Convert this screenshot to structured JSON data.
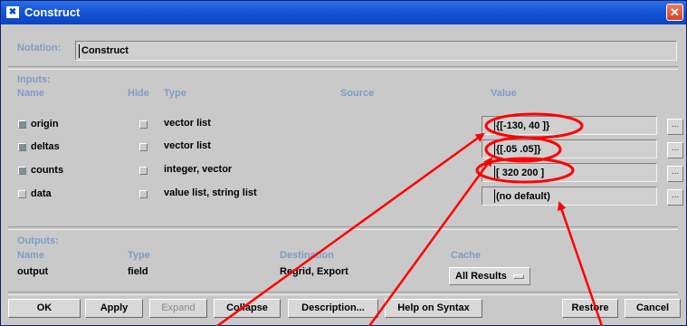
{
  "window": {
    "title": "Construct",
    "icon": "module-icon",
    "close_glyph": "✕"
  },
  "notation": {
    "label": "Notation:",
    "value": "Construct"
  },
  "inputs": {
    "section_label": "Inputs:",
    "headers": {
      "name": "Name",
      "hide": "Hide",
      "type": "Type",
      "source": "Source",
      "value": "Value"
    },
    "rows": [
      {
        "name": "origin",
        "checked": true,
        "type": "vector list",
        "value": "{[-130, 40 ]}"
      },
      {
        "name": "deltas",
        "checked": true,
        "type": "vector list",
        "value": "{[.05 .05]}"
      },
      {
        "name": "counts",
        "checked": true,
        "type": "integer, vector",
        "value": "[ 320 200 ]"
      },
      {
        "name": "data",
        "checked": false,
        "type": "value list, string list",
        "value": "(no default)"
      }
    ],
    "browse_label": "..."
  },
  "outputs": {
    "section_label": "Outputs:",
    "headers": {
      "name": "Name",
      "type": "Type",
      "destination": "Destination",
      "cache": "Cache"
    },
    "rows": [
      {
        "name": "output",
        "type": "field",
        "destination": "Regrid, Export",
        "cache": "All Results"
      }
    ]
  },
  "buttons": {
    "ok": "OK",
    "apply": "Apply",
    "expand": "Expand",
    "collapse": "Collapse",
    "description": "Description...",
    "help": "Help on Syntax",
    "restore": "Restore",
    "cancel": "Cancel"
  },
  "colors": {
    "title_bar": "#1557d8",
    "annotation": "#ff0000",
    "section_label": "#7d9cc8"
  }
}
